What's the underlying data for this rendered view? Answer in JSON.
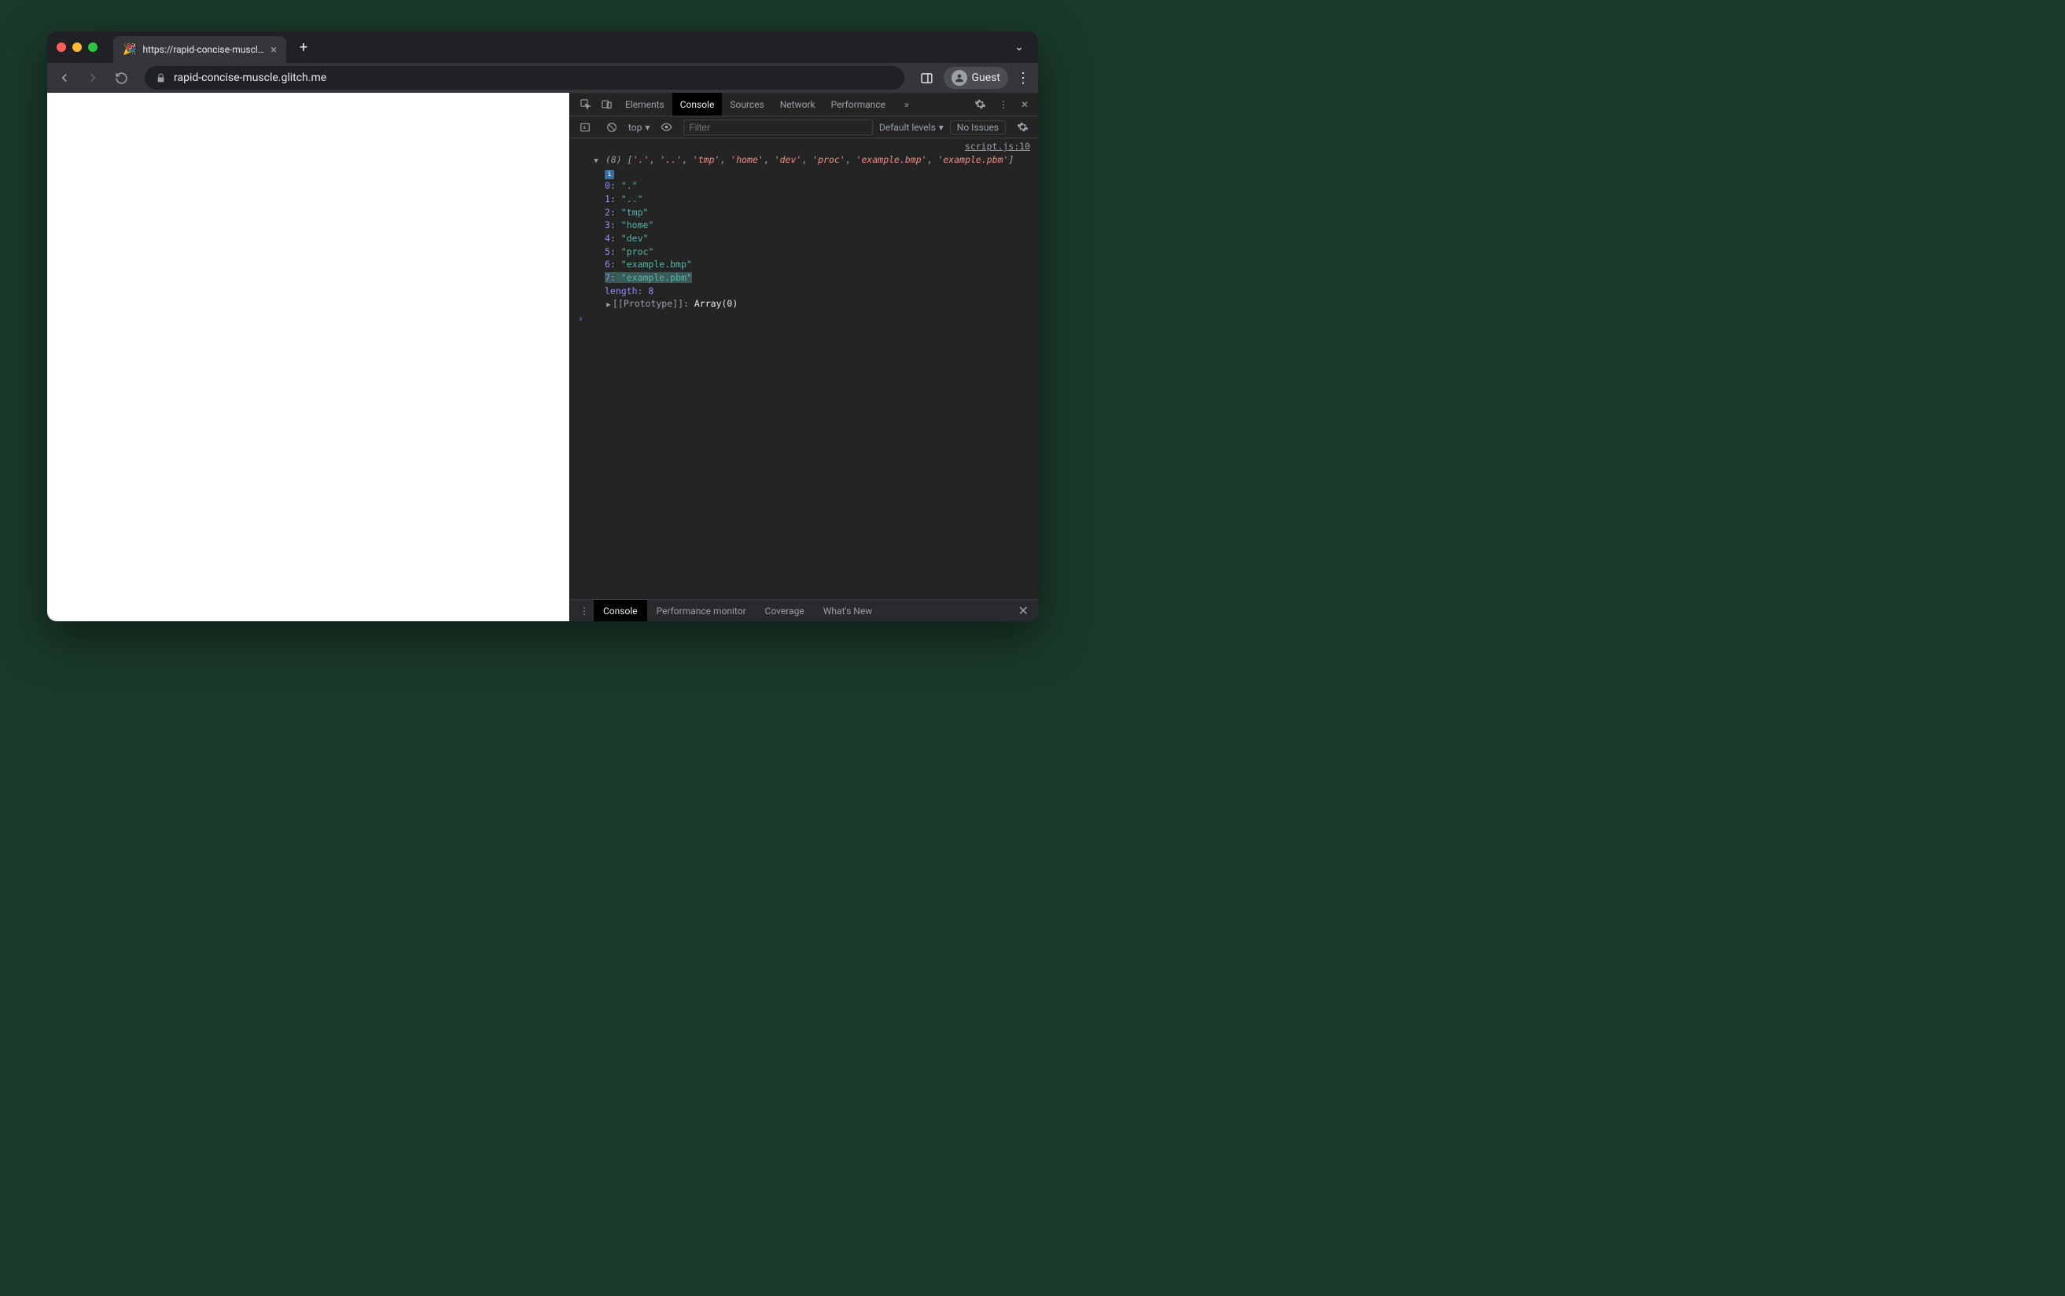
{
  "tab": {
    "favicon": "🎉",
    "title": "https://rapid-concise-muscle.g",
    "close": "×",
    "newtab": "+"
  },
  "toolbar": {
    "url": "rapid-concise-muscle.glitch.me",
    "guest": "Guest",
    "tabs_dropdown": "⌄"
  },
  "devtools": {
    "tabs": {
      "elements": "Elements",
      "console": "Console",
      "sources": "Sources",
      "network": "Network",
      "performance": "Performance",
      "more": "»"
    },
    "console_toolbar": {
      "context": "top",
      "filter_placeholder": "Filter",
      "levels": "Default levels",
      "noissues": "No Issues"
    },
    "log": {
      "source_link": "script.js:10",
      "count": "(8)",
      "summary_items": [
        "'.'",
        "'..'",
        "'tmp'",
        "'home'",
        "'dev'",
        "'proc'",
        "'example.bmp'",
        "'example.pbm'"
      ],
      "items": [
        {
          "i": "0",
          "v": "\".\""
        },
        {
          "i": "1",
          "v": "\"..\""
        },
        {
          "i": "2",
          "v": "\"tmp\""
        },
        {
          "i": "3",
          "v": "\"home\""
        },
        {
          "i": "4",
          "v": "\"dev\""
        },
        {
          "i": "5",
          "v": "\"proc\""
        },
        {
          "i": "6",
          "v": "\"example.bmp\""
        },
        {
          "i": "7",
          "v": "\"example.pbm\""
        }
      ],
      "length_label": "length",
      "length_val": "8",
      "proto_label": "[[Prototype]]",
      "proto_val": "Array(0)"
    },
    "drawer": {
      "console": "Console",
      "perfmon": "Performance monitor",
      "coverage": "Coverage",
      "whatsnew": "What's New"
    }
  }
}
